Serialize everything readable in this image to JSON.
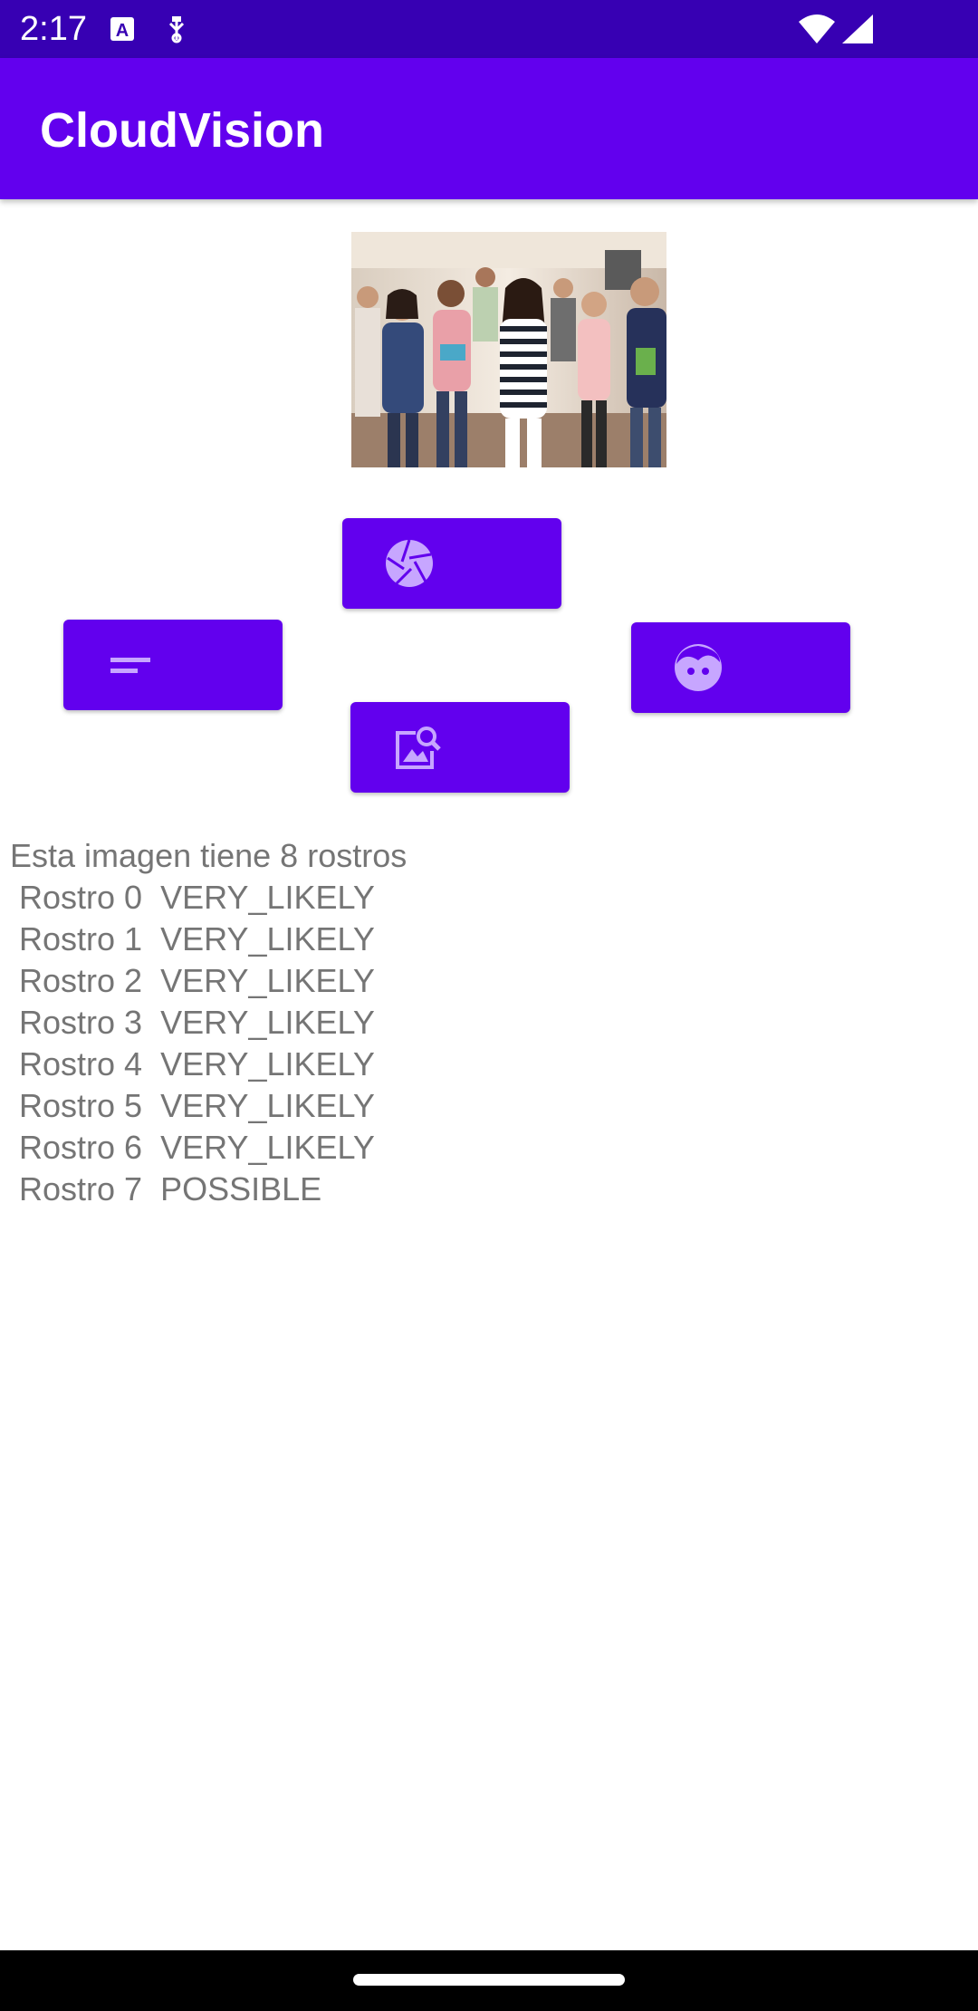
{
  "status_bar": {
    "time": "2:17",
    "icons": [
      "keyboard-a-icon",
      "usb-debug-icon",
      "wifi-icon",
      "cell-signal-icon"
    ]
  },
  "app_bar": {
    "title": "CloudVision",
    "color": "#6200ee"
  },
  "photo": {
    "subject": "group of eight smiling people standing in an office"
  },
  "buttons": [
    {
      "id": "camera",
      "icon": "camera-shutter-icon"
    },
    {
      "id": "text",
      "icon": "text-lines-icon"
    },
    {
      "id": "face",
      "icon": "face-icon"
    },
    {
      "id": "image-search",
      "icon": "image-search-icon"
    }
  ],
  "results": {
    "title": "Esta imagen tiene 8 rostros",
    "faces": [
      {
        "label": "Rostro 0",
        "likelihood": "VERY_LIKELY"
      },
      {
        "label": "Rostro 1",
        "likelihood": "VERY_LIKELY"
      },
      {
        "label": "Rostro 2",
        "likelihood": "VERY_LIKELY"
      },
      {
        "label": "Rostro 3",
        "likelihood": "VERY_LIKELY"
      },
      {
        "label": "Rostro 4",
        "likelihood": "VERY_LIKELY"
      },
      {
        "label": "Rostro 5",
        "likelihood": "VERY_LIKELY"
      },
      {
        "label": "Rostro 6",
        "likelihood": "VERY_LIKELY"
      },
      {
        "label": "Rostro 7",
        "likelihood": "POSSIBLE"
      }
    ]
  },
  "colors": {
    "status_bar": "#3700b3",
    "primary": "#6200ee",
    "text_secondary": "#757575"
  }
}
